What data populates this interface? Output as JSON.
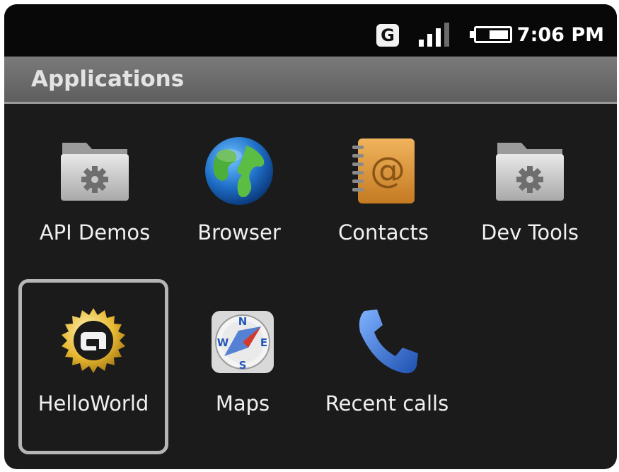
{
  "status_bar": {
    "network_type": "G",
    "signal_icon": "signal-bars-icon",
    "battery_icon": "battery-icon",
    "time": "7:06 PM"
  },
  "header": {
    "title": "Applications"
  },
  "apps": [
    {
      "label": "API Demos",
      "icon": "folder-gear-icon"
    },
    {
      "label": "Browser",
      "icon": "globe-icon"
    },
    {
      "label": "Contacts",
      "icon": "address-book-icon"
    },
    {
      "label": "Dev Tools",
      "icon": "folder-gear-icon"
    },
    {
      "label": "HelloWorld",
      "icon": "android-app-icon",
      "focused": true
    },
    {
      "label": "Maps",
      "icon": "compass-icon"
    },
    {
      "label": "Recent calls",
      "icon": "phone-icon"
    }
  ]
}
